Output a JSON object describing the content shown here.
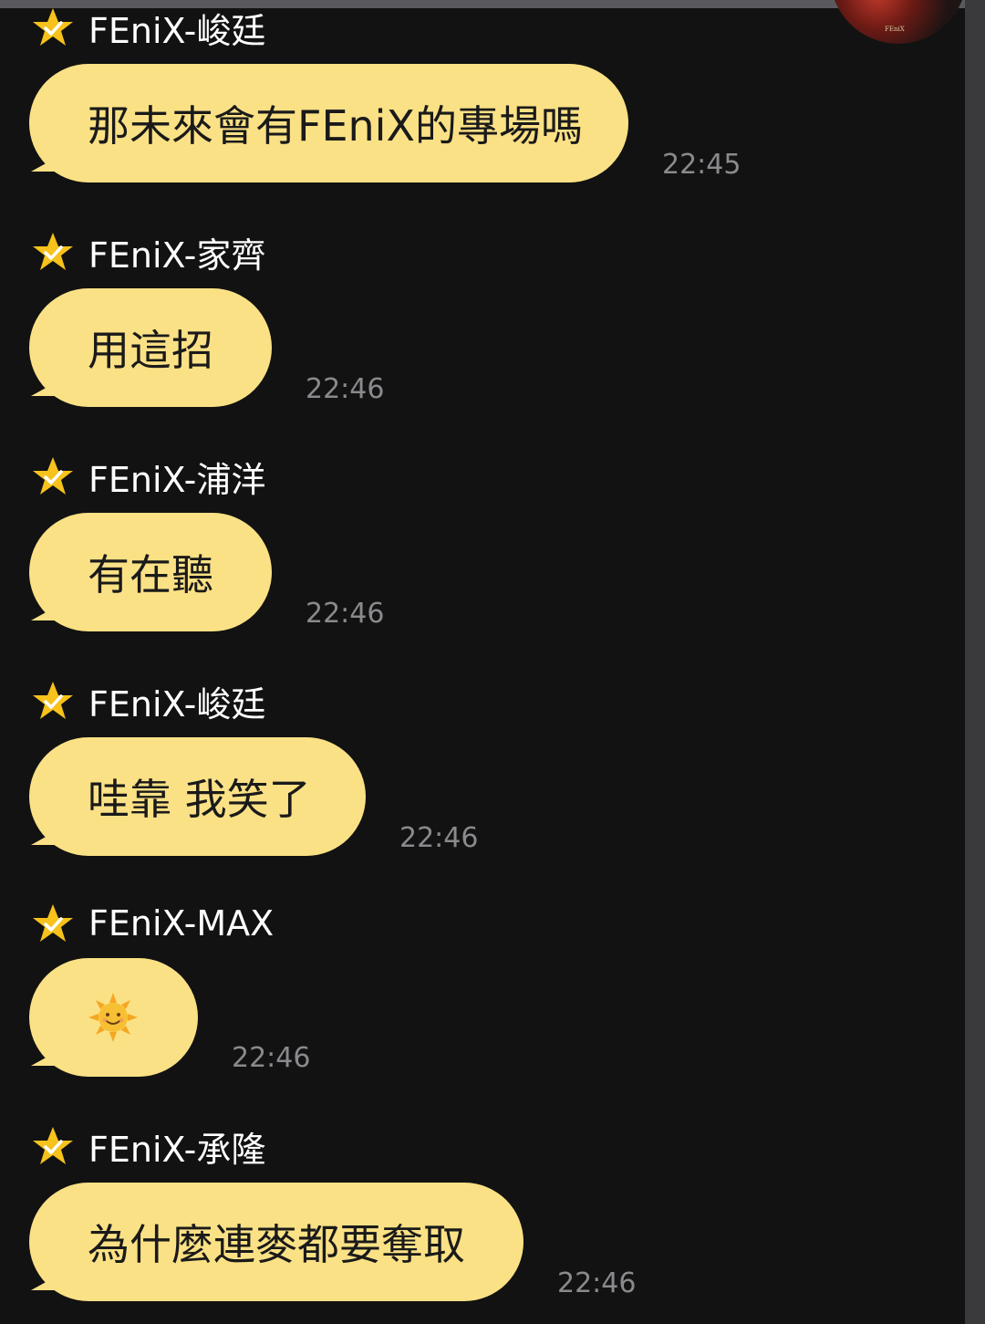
{
  "chat": {
    "messages": [
      {
        "sender": "FEniX-峻廷",
        "text": "那未來會有FEniX的專場嗎",
        "time": "22:45",
        "sender_badge": "star-check-icon"
      },
      {
        "sender": "FEniX-家齊",
        "text": "用這招",
        "time": "22:46",
        "sender_badge": "star-check-icon"
      },
      {
        "sender": "FEniX-浦洋",
        "text": "有在聽",
        "time": "22:46",
        "sender_badge": "star-check-icon"
      },
      {
        "sender": "FEniX-峻廷",
        "text": "哇靠 我笑了",
        "time": "22:46",
        "sender_badge": "star-check-icon"
      },
      {
        "sender": "FEniX-MAX",
        "text": "",
        "emoji": "sun-emoji",
        "time": "22:46",
        "sender_badge": "star-check-icon"
      },
      {
        "sender": "FEniX-承隆",
        "text": "為什麼連麥都要奪取",
        "time": "22:46",
        "sender_badge": "star-check-icon"
      }
    ]
  },
  "theme": {
    "background": "#121212",
    "bubble": "#fbe185",
    "bubble_text": "#1a1a1a",
    "sender_text": "#ffffff",
    "time_text": "#8a8a8e",
    "star": "#f6c21b"
  }
}
